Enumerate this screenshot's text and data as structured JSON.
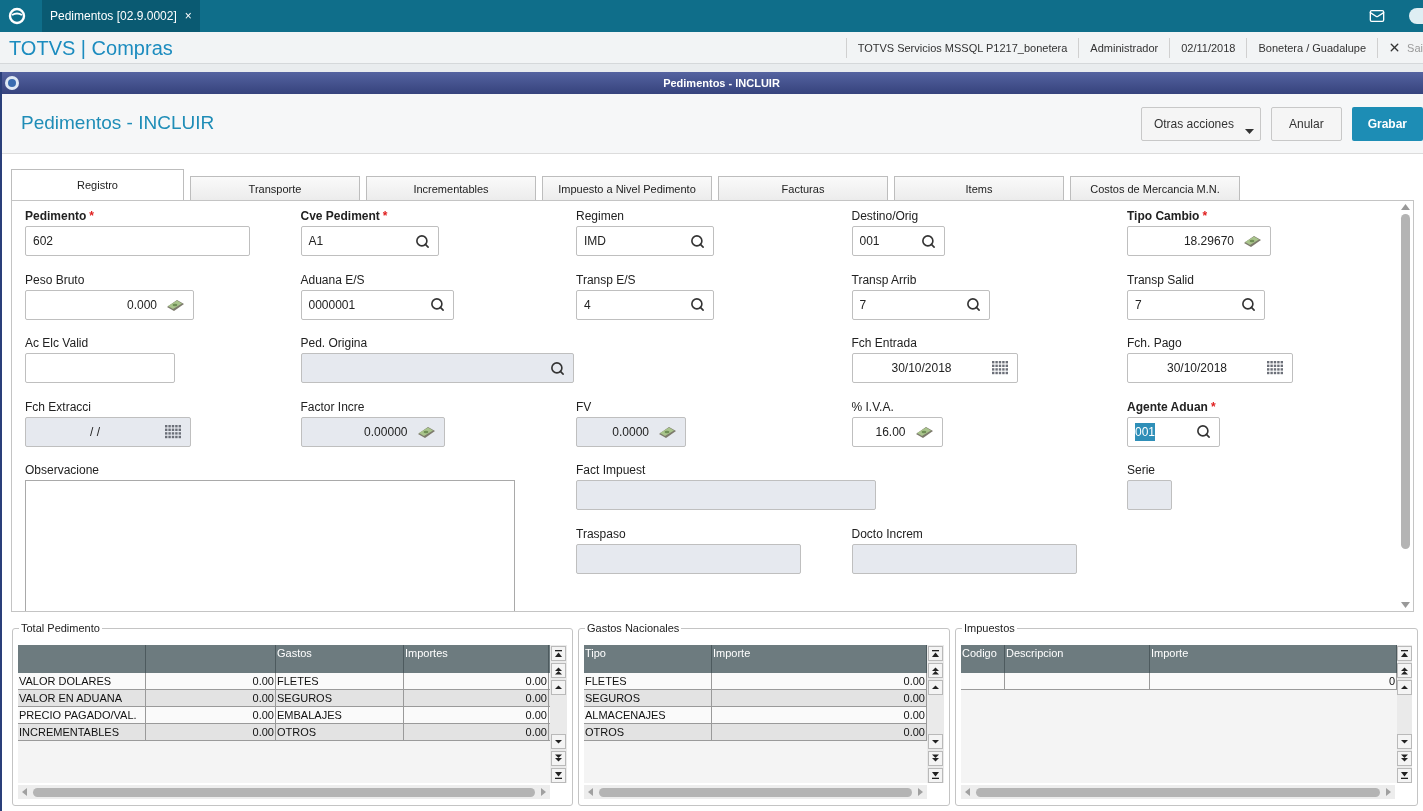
{
  "app_bar": {
    "tab": {
      "label": "Pedimentos [02.9.0002]",
      "close": "×"
    }
  },
  "header_bar": {
    "brand": "TOTVS | Compras",
    "info": [
      "TOTVS Servicios MSSQL P1217_bonetera",
      "Administrador",
      "02/11/2018",
      "Bonetera / Guadalupe"
    ],
    "exit": "Sai"
  },
  "window": {
    "title": "Pedimentos - INCLUIR"
  },
  "page": {
    "title": "Pedimentos - INCLUIR",
    "buttons": [
      {
        "label": "Otras acciones",
        "kind": "menu"
      },
      {
        "label": "Anular",
        "kind": "plain"
      },
      {
        "label": "Grabar",
        "kind": "primary"
      }
    ]
  },
  "tabs": [
    {
      "label": "Registro",
      "selected": true
    },
    {
      "label": "Transporte",
      "selected": false
    },
    {
      "label": "Incrementables",
      "selected": false
    },
    {
      "label": "Impuesto a Nivel Pedimento",
      "selected": false
    },
    {
      "label": "Facturas",
      "selected": false
    },
    {
      "label": "Items",
      "selected": false
    },
    {
      "label": "Costos de Mercancia M.N.",
      "selected": false
    }
  ],
  "fields": [
    {
      "label": "Pedimento",
      "required_mark": "*",
      "kind": "text",
      "value": "602",
      "disabled": false
    },
    {
      "label": "Cve Pediment",
      "required_mark": "*",
      "kind": "lookup",
      "value": "A1",
      "disabled": false
    },
    {
      "label": "Regimen",
      "kind": "lookup",
      "value": "IMD",
      "disabled": false
    },
    {
      "label": "Destino/Orig",
      "kind": "lookup",
      "value": "001",
      "disabled": false
    },
    {
      "label": "Tipo Cambio",
      "required_mark": "*",
      "kind": "number",
      "value": "18.29670",
      "disabled": false
    },
    {
      "label": "Peso Bruto",
      "kind": "number",
      "value": "0.000",
      "disabled": false
    },
    {
      "label": "Aduana E/S",
      "kind": "lookup",
      "value": "0000001",
      "disabled": false
    },
    {
      "label": "Transp E/S",
      "kind": "lookup",
      "value": "4",
      "disabled": false
    },
    {
      "label": "Transp Arrib",
      "kind": "lookup",
      "value": "7",
      "disabled": false
    },
    {
      "label": "Transp Salid",
      "kind": "lookup",
      "value": "7",
      "disabled": false
    },
    {
      "label": "Ac Elc Valid",
      "kind": "text",
      "disabled": false
    },
    {
      "label": "Ped. Origina",
      "kind": "lookup",
      "disabled": true
    },
    {
      "label": "Fch Entrada",
      "kind": "date",
      "value": "30/10/2018",
      "disabled": false
    },
    {
      "label": "Fch. Pago",
      "kind": "date",
      "value": "30/10/2018",
      "disabled": false
    },
    {
      "label": "Fch Extracci",
      "kind": "date",
      "value": "/ /",
      "disabled": true
    },
    {
      "label": "Factor Incre",
      "kind": "number",
      "value": "0.00000",
      "disabled": true
    },
    {
      "label": "FV",
      "kind": "number",
      "value": "0.0000",
      "disabled": true
    },
    {
      "label": "% I.V.A.",
      "kind": "number",
      "value": "16.00",
      "disabled": false
    },
    {
      "label": "Agente Aduan",
      "required_mark": "*",
      "kind": "lookup",
      "value": "001",
      "value_selected": true,
      "disabled": false
    },
    {
      "label": "Observacione",
      "kind": "memo",
      "disabled": false
    },
    {
      "label": "Fact Impuest",
      "kind": "text",
      "disabled": true
    },
    {
      "label": "Serie",
      "kind": "text",
      "disabled": true
    },
    {
      "label": "Traspaso",
      "kind": "text",
      "disabled": true
    },
    {
      "label": "Docto Increm",
      "kind": "text",
      "disabled": true
    }
  ],
  "groups": [
    {
      "title": "Total Pedimento",
      "columns": [
        {
          "kind": "text"
        },
        {
          "kind": "number"
        },
        {
          "kind": "text",
          "label": "Gastos"
        },
        {
          "kind": "number",
          "label": "Importes"
        }
      ],
      "rows": [
        [
          "VALOR DOLARES",
          "0.00",
          "FLETES",
          "0.00"
        ],
        [
          "VALOR EN ADUANA",
          "0.00",
          "SEGUROS",
          "0.00"
        ],
        [
          "PRECIO PAGADO/VAL.",
          "0.00",
          "EMBALAJES",
          "0.00"
        ],
        [
          "INCREMENTABLES",
          "0.00",
          "OTROS",
          "0.00"
        ]
      ]
    },
    {
      "title": "Gastos Nacionales",
      "columns": [
        {
          "kind": "text",
          "label": "Tipo"
        },
        {
          "kind": "number",
          "label": "Importe"
        }
      ],
      "rows": [
        [
          "FLETES",
          "0.00"
        ],
        [
          "SEGUROS",
          "0.00"
        ],
        [
          "ALMACENAJES",
          "0.00"
        ],
        [
          "OTROS",
          "0.00"
        ]
      ]
    },
    {
      "title": "Impuestos",
      "columns": [
        {
          "kind": "text",
          "label": "Codigo"
        },
        {
          "kind": "text",
          "label": "Descripcion"
        },
        {
          "kind": "number",
          "label": "Importe"
        }
      ],
      "rows": [
        [
          null,
          null,
          "0"
        ]
      ]
    }
  ]
}
